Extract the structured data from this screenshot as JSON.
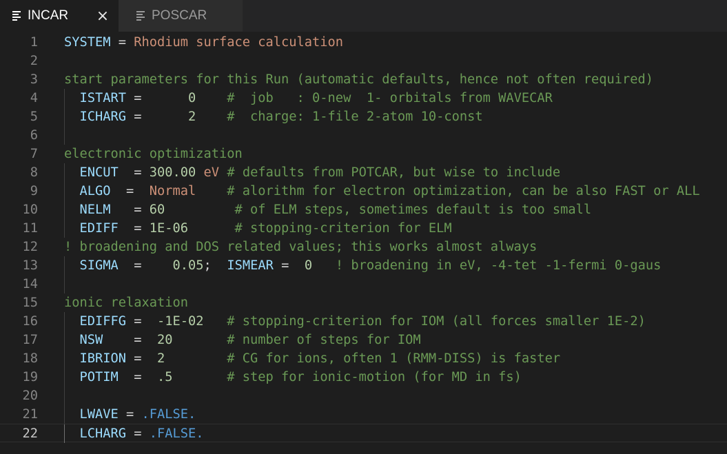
{
  "tabs": [
    {
      "label": "INCAR",
      "active": true,
      "icon": "file-lines-icon"
    },
    {
      "label": "POSCAR",
      "active": false,
      "icon": "file-lines-icon"
    }
  ],
  "colors": {
    "background": "#1e1e1e",
    "keyword": "#9cdcfe",
    "string": "#ce9178",
    "comment": "#6a9955",
    "number": "#b5cea8",
    "boolean": "#569cd6",
    "plain": "#d4d4d4"
  },
  "current_line": 22,
  "lines": [
    {
      "n": "1",
      "indent": false,
      "tokens": [
        {
          "t": "SYSTEM",
          "c": "k"
        },
        {
          "t": " = ",
          "c": "p"
        },
        {
          "t": "Rhodium surface calculation",
          "c": "s"
        }
      ]
    },
    {
      "n": "2",
      "indent": false,
      "tokens": []
    },
    {
      "n": "3",
      "indent": false,
      "tokens": [
        {
          "t": "start parameters for this Run (automatic defaults, hence not often required)",
          "c": "c"
        }
      ]
    },
    {
      "n": "4",
      "indent": true,
      "tokens": [
        {
          "t": "  ISTART",
          "c": "k"
        },
        {
          "t": " =      ",
          "c": "p"
        },
        {
          "t": "0",
          "c": "n"
        },
        {
          "t": "    #  job   : 0-new  1- orbitals from WAVECAR",
          "c": "c"
        }
      ]
    },
    {
      "n": "5",
      "indent": true,
      "tokens": [
        {
          "t": "  ICHARG",
          "c": "k"
        },
        {
          "t": " =      ",
          "c": "p"
        },
        {
          "t": "2",
          "c": "n"
        },
        {
          "t": "    #  charge: 1-file 2-atom 10-const",
          "c": "c"
        }
      ]
    },
    {
      "n": "6",
      "indent": true,
      "tokens": []
    },
    {
      "n": "7",
      "indent": false,
      "tokens": [
        {
          "t": "electronic optimization",
          "c": "c"
        }
      ]
    },
    {
      "n": "8",
      "indent": true,
      "tokens": [
        {
          "t": "  ENCUT",
          "c": "k"
        },
        {
          "t": "  = ",
          "c": "p"
        },
        {
          "t": "300.00",
          "c": "n"
        },
        {
          "t": " eV",
          "c": "s"
        },
        {
          "t": " # defaults from POTCAR, but wise to include",
          "c": "c"
        }
      ]
    },
    {
      "n": "9",
      "indent": true,
      "tokens": [
        {
          "t": "  ALGO",
          "c": "k"
        },
        {
          "t": "  =  ",
          "c": "p"
        },
        {
          "t": "Normal",
          "c": "s"
        },
        {
          "t": "    # alorithm for electron optimization, can be also FAST or ALL",
          "c": "c"
        }
      ]
    },
    {
      "n": "10",
      "indent": true,
      "tokens": [
        {
          "t": "  NELM",
          "c": "k"
        },
        {
          "t": "   = ",
          "c": "p"
        },
        {
          "t": "60",
          "c": "n"
        },
        {
          "t": "         # of ELM steps, sometimes default is too small",
          "c": "c"
        }
      ]
    },
    {
      "n": "11",
      "indent": true,
      "tokens": [
        {
          "t": "  EDIFF",
          "c": "k"
        },
        {
          "t": "  = ",
          "c": "p"
        },
        {
          "t": "1E-06",
          "c": "n"
        },
        {
          "t": "      # stopping-criterion for ELM",
          "c": "c"
        }
      ]
    },
    {
      "n": "12",
      "indent": false,
      "tokens": [
        {
          "t": "! broadening and DOS related values; this works almost always",
          "c": "c"
        }
      ]
    },
    {
      "n": "13",
      "indent": true,
      "tokens": [
        {
          "t": "  SIGMA",
          "c": "k"
        },
        {
          "t": "  =    ",
          "c": "p"
        },
        {
          "t": "0.05",
          "c": "n"
        },
        {
          "t": ";  ",
          "c": "p"
        },
        {
          "t": "ISMEAR",
          "c": "k"
        },
        {
          "t": " =  ",
          "c": "p"
        },
        {
          "t": "0",
          "c": "n"
        },
        {
          "t": "   ! broadening in eV, -4-tet -1-fermi 0-gaus",
          "c": "c"
        }
      ]
    },
    {
      "n": "14",
      "indent": true,
      "tokens": []
    },
    {
      "n": "15",
      "indent": false,
      "tokens": [
        {
          "t": "ionic relaxation",
          "c": "c"
        }
      ]
    },
    {
      "n": "16",
      "indent": true,
      "tokens": [
        {
          "t": "  EDIFFG",
          "c": "k"
        },
        {
          "t": " =  ",
          "c": "p"
        },
        {
          "t": "-1E-02",
          "c": "n"
        },
        {
          "t": "   # stopping-criterion for IOM (all forces smaller 1E-2)",
          "c": "c"
        }
      ]
    },
    {
      "n": "17",
      "indent": true,
      "tokens": [
        {
          "t": "  NSW",
          "c": "k"
        },
        {
          "t": "    =  ",
          "c": "p"
        },
        {
          "t": "20",
          "c": "n"
        },
        {
          "t": "       # number of steps for IOM",
          "c": "c"
        }
      ]
    },
    {
      "n": "18",
      "indent": true,
      "tokens": [
        {
          "t": "  IBRION",
          "c": "k"
        },
        {
          "t": " =  ",
          "c": "p"
        },
        {
          "t": "2",
          "c": "n"
        },
        {
          "t": "        # CG for ions, often 1 (RMM-DISS) is faster",
          "c": "c"
        }
      ]
    },
    {
      "n": "19",
      "indent": true,
      "tokens": [
        {
          "t": "  POTIM",
          "c": "k"
        },
        {
          "t": "  =  ",
          "c": "p"
        },
        {
          "t": ".5",
          "c": "n"
        },
        {
          "t": "       # step for ionic-motion (for MD in fs)",
          "c": "c"
        }
      ]
    },
    {
      "n": "20",
      "indent": true,
      "tokens": []
    },
    {
      "n": "21",
      "indent": true,
      "tokens": [
        {
          "t": "  LWAVE",
          "c": "k"
        },
        {
          "t": " = ",
          "c": "p"
        },
        {
          "t": ".FALSE.",
          "c": "b"
        }
      ]
    },
    {
      "n": "22",
      "indent": true,
      "tokens": [
        {
          "t": "  LCHARG",
          "c": "k"
        },
        {
          "t": " = ",
          "c": "p"
        },
        {
          "t": ".FALSE.",
          "c": "b"
        }
      ]
    }
  ]
}
